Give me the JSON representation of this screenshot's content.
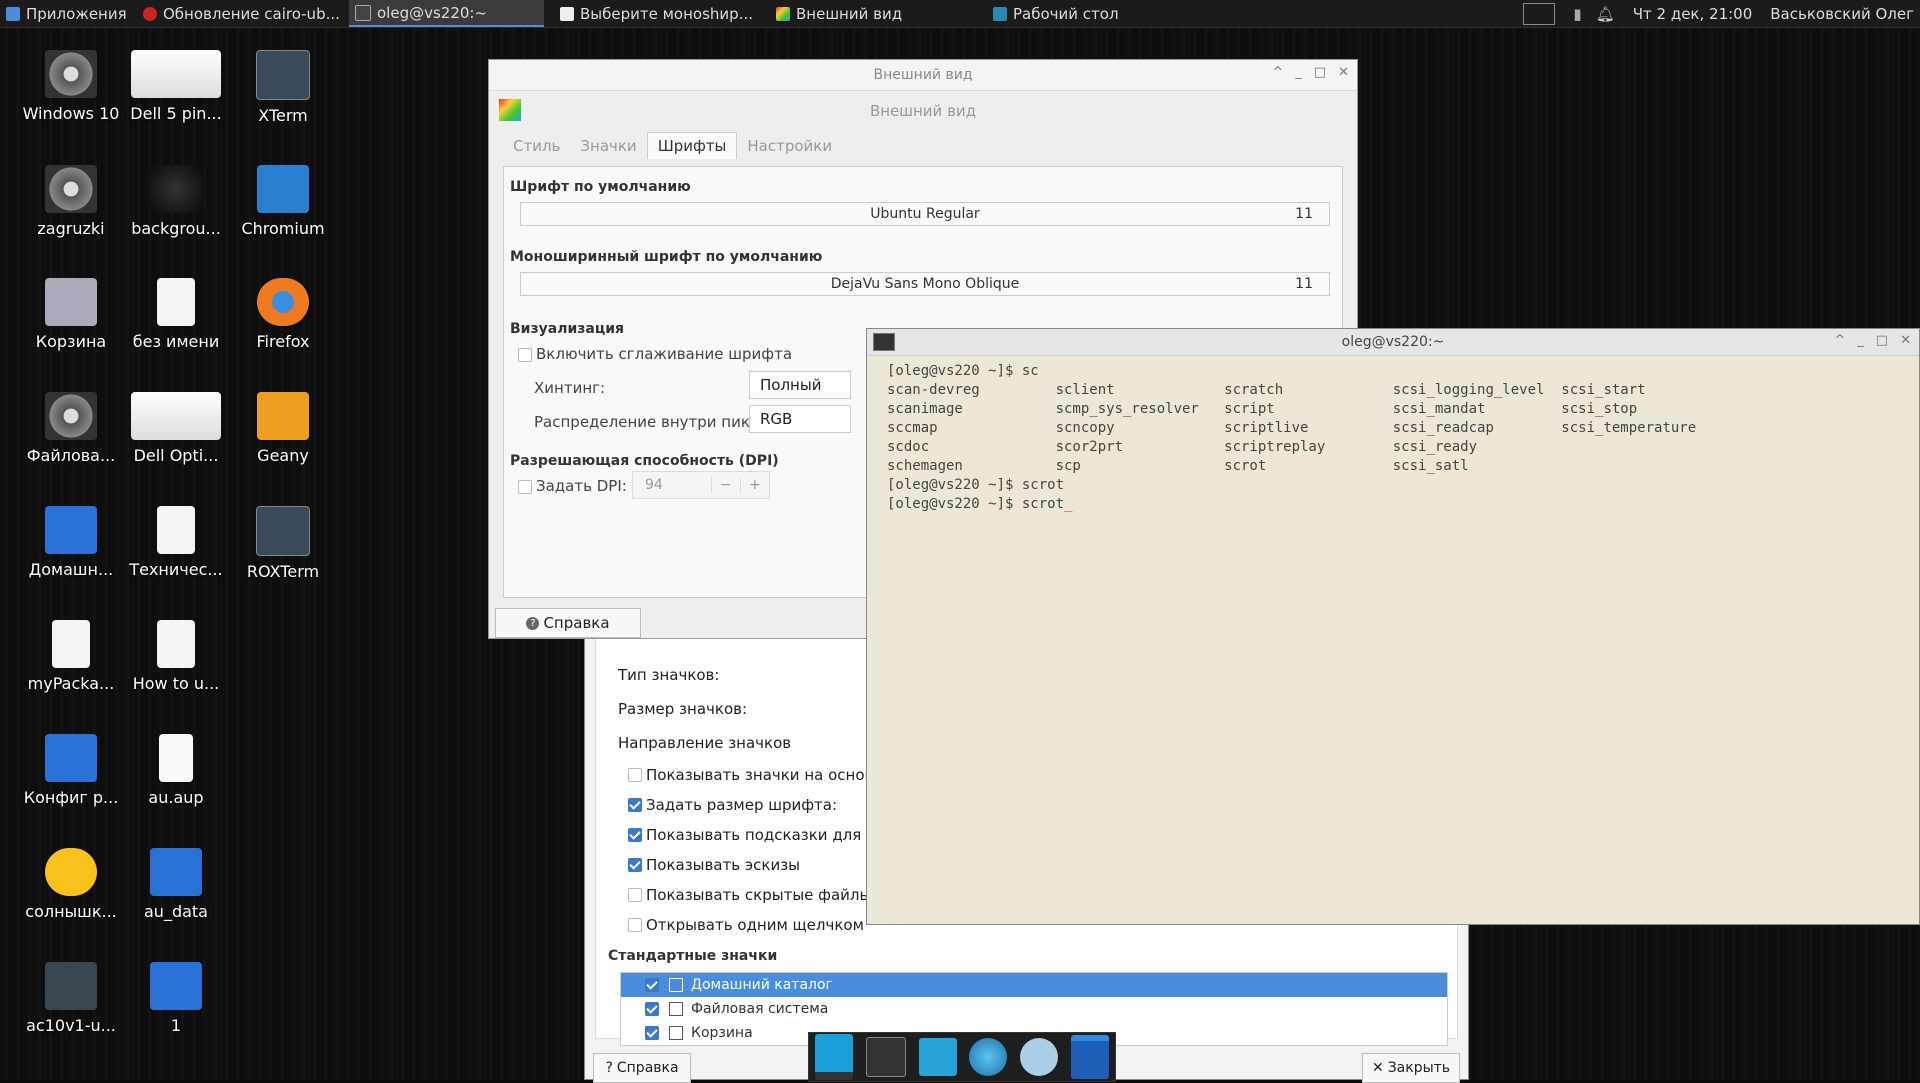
{
  "panel": {
    "tasks": [
      {
        "label": "Приложения"
      },
      {
        "label": "Обновление cairo-ub..."
      },
      {
        "label": "oleg@vs220:~"
      },
      {
        "label": "Выберите моноshир..."
      },
      {
        "label": "Внешний вид"
      },
      {
        "label": "Рабочий стол"
      }
    ],
    "clock": "Чт 2 дек, 21:00",
    "user": "Васьковский Олег"
  },
  "desktop_icons": [
    {
      "label": "Windows 10",
      "icon": "disk-icon"
    },
    {
      "label": "Dell 5 pin...",
      "icon": "screenshot-icon"
    },
    {
      "label": "XTerm",
      "icon": "terminal-icon"
    },
    {
      "label": "zagruzki",
      "icon": "disk-icon"
    },
    {
      "label": "backgrou...",
      "icon": "image-icon"
    },
    {
      "label": "Chromium",
      "icon": "chromium-icon"
    },
    {
      "label": "Корзина",
      "icon": "trash-icon"
    },
    {
      "label": "без имени",
      "icon": "document-icon"
    },
    {
      "label": "Firefox",
      "icon": "firefox-icon"
    },
    {
      "label": "Файлова...",
      "icon": "disk-icon"
    },
    {
      "label": "Dell Opti...",
      "icon": "screenshot-icon"
    },
    {
      "label": "Geany",
      "icon": "geany-icon"
    },
    {
      "label": "Домашн...",
      "icon": "home-folder-icon"
    },
    {
      "label": "Техничес...",
      "icon": "document-icon"
    },
    {
      "label": "ROXTerm",
      "icon": "terminal-icon"
    },
    {
      "label": "myPacka...",
      "icon": "document-icon"
    },
    {
      "label": "How to u...",
      "icon": "document-icon"
    },
    {
      "label": "Конфиг р...",
      "icon": "folder-icon"
    },
    {
      "label": "au.aup",
      "icon": "file-icon"
    },
    {
      "label": "солнышк...",
      "icon": "sun-icon"
    },
    {
      "label": "au_data",
      "icon": "folder-icon"
    },
    {
      "label": "ac10v1-u...",
      "icon": "grid-icon"
    },
    {
      "label": "1",
      "icon": "folder-icon"
    }
  ],
  "appearance": {
    "title": "Внешний вид",
    "header": "Внешний вид",
    "tabs": [
      "Стиль",
      "Значки",
      "Шрифты",
      "Настройки"
    ],
    "default_font_label": "Шрифт по умолчанию",
    "default_font": "Ubuntu Regular",
    "default_font_size": "11",
    "mono_font_label": "Моноширинный шрифт по умолчанию",
    "mono_font": "DejaVu Sans Mono Oblique",
    "mono_font_size": "11",
    "render_label": "Визуализация",
    "antialias_label": "Включить сглаживание шрифта",
    "hinting_label": "Хинтинг:",
    "hinting_value": "Полный",
    "subpixel_label": "Распределение внутри пикселя:",
    "subpixel_value": "RGB",
    "dpi_label": "Разрешающая способность (DPI)",
    "set_dpi_label": "Задать DPI:",
    "dpi_value": "94",
    "help_button": "Справка"
  },
  "desktop_settings": {
    "rows": [
      {
        "label": "Тип значков:",
        "checkbox": false
      },
      {
        "label": "Размер значков:",
        "checkbox": false
      },
      {
        "label": "Направление значков",
        "checkbox": false
      }
    ],
    "checks": [
      {
        "label": "Показывать значки на основно",
        "on": false
      },
      {
        "label": "Задать размер шрифта:",
        "on": true
      },
      {
        "label": "Показывать подсказки для знач",
        "on": true
      },
      {
        "label": "Показывать эскизы",
        "on": true
      },
      {
        "label": "Показывать скрытые файлы на",
        "on": false
      },
      {
        "label": "Открывать одним щелчком",
        "on": false
      }
    ],
    "std_icons_label": "Стандартные значки",
    "std_icons": [
      {
        "label": "Домашний каталог",
        "icon": "home-icon",
        "selected": true
      },
      {
        "label": "Файловая система",
        "icon": "filesystem-icon",
        "selected": false
      },
      {
        "label": "Корзина",
        "icon": "trash-icon",
        "selected": false
      }
    ],
    "help_button": "Справка",
    "close_button": "Закрыть"
  },
  "terminal": {
    "title": "oleg@vs220:~",
    "lines": [
      "[oleg@vs220 ~]$ sc",
      "scan-devreg         sclient             scratch             scsi_logging_level  scsi_start",
      "scanimage           scmp_sys_resolver   script              scsi_mandat         scsi_stop",
      "sccmap              scncopy             scriptlive          scsi_readcap        scsi_temperature",
      "scdoc               scor2prt            scriptreplay        scsi_ready",
      "schemagen           scp                 scrot               scsi_satl",
      "[oleg@vs220 ~]$ scrot",
      "[oleg@vs220 ~]$ scrot_"
    ]
  },
  "colors": {
    "accent": "#4a8ddc",
    "terminal_bg": "#ece7d6",
    "panel_bg": "#1b1b1b"
  }
}
